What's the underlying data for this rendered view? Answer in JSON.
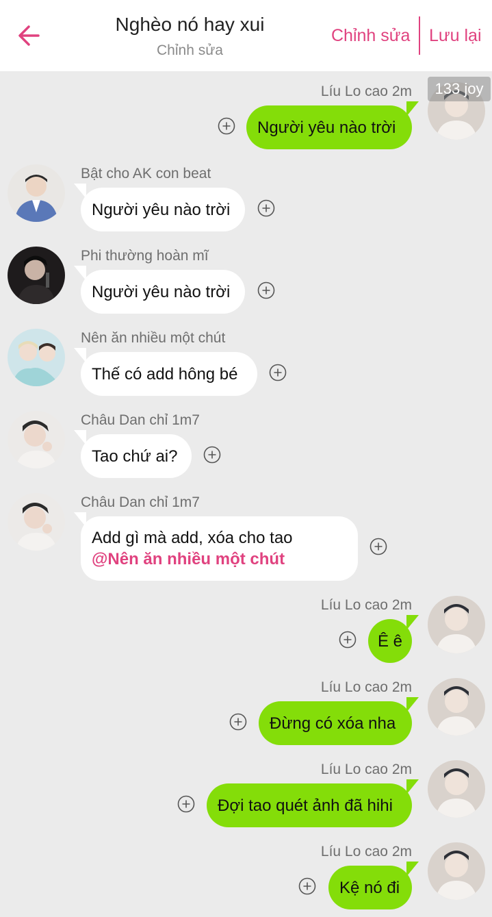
{
  "header": {
    "title": "Nghèo nó hay xui",
    "subtitle": "Chỉnh sửa",
    "edit_label": "Chỉnh sửa",
    "save_label": "Lưu lại",
    "accent_color": "#e0427f"
  },
  "badge": {
    "text": "133 joy"
  },
  "bubble_colors": {
    "outgoing": "#84dd09",
    "incoming": "#ffffff"
  },
  "messages": [
    {
      "sender": "Líu Lo cao 2m",
      "text": "Người yêu nào trời"
    },
    {
      "sender": "Bật cho AK con beat",
      "text": "Người yêu nào trời"
    },
    {
      "sender": "Phi thường hoàn mĩ",
      "text": "Người yêu nào trời"
    },
    {
      "sender": "Nên ăn nhiều một chút",
      "text": "Thế có add hông bé"
    },
    {
      "sender": "Châu Dan chỉ 1m7",
      "text": "Tao chứ ai?"
    },
    {
      "sender": "Châu Dan chỉ 1m7",
      "text": "Add gì mà add, xóa cho tao",
      "mention": "@Nên ăn nhiều một chút"
    },
    {
      "sender": "Líu Lo cao 2m",
      "text": "Ê ê"
    },
    {
      "sender": "Líu Lo cao 2m",
      "text": "Đừng có xóa nha"
    },
    {
      "sender": "Líu Lo cao 2m",
      "text": "Đợi tao quét ảnh đã hihi"
    },
    {
      "sender": "Líu Lo cao 2m",
      "text": "Kệ nó đi"
    }
  ]
}
